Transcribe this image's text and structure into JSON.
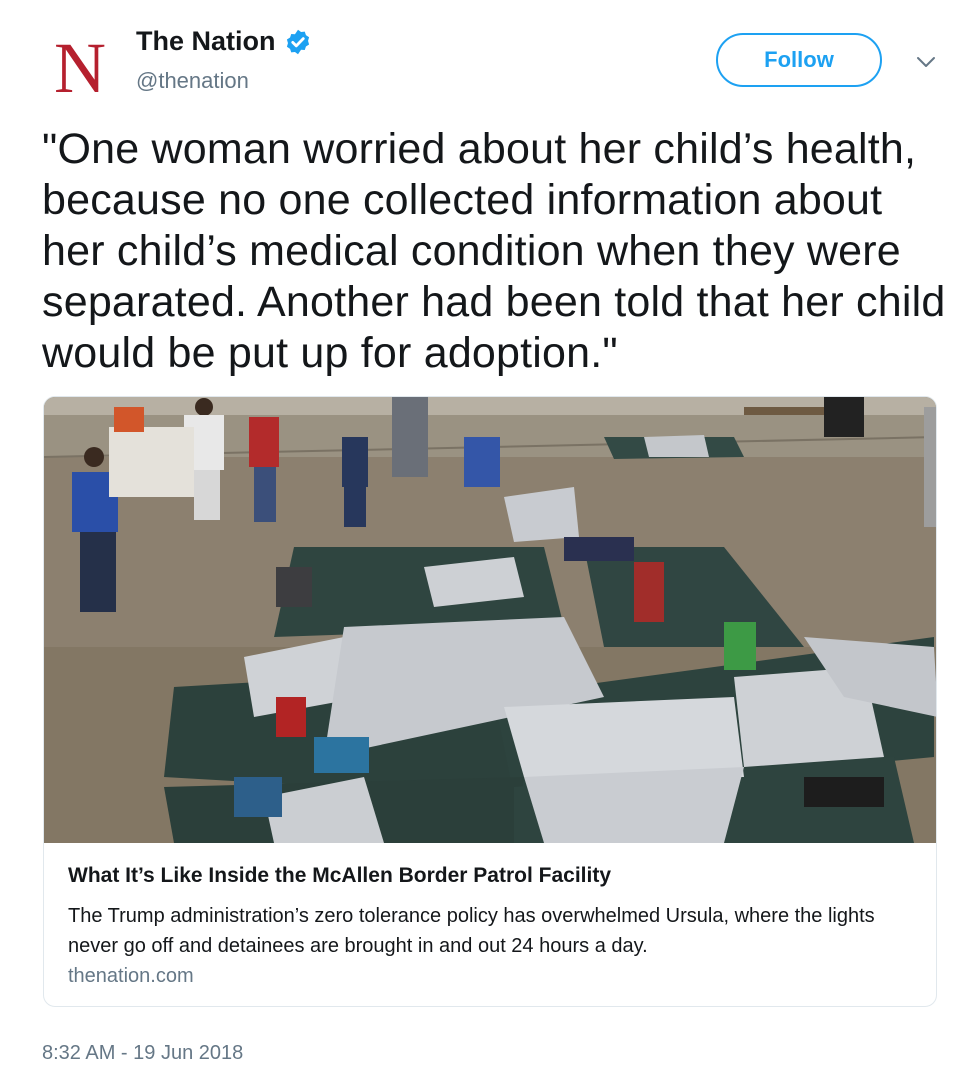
{
  "account": {
    "logo_letter": "N",
    "display_name": "The Nation",
    "handle": "@thenation",
    "verified": true
  },
  "follow_label": "Follow",
  "tweet": {
    "text": "\"One woman worried about her child’s health, because no one collected information about her child’s medical condition when they were separated. Another had been told that her child would be put up for adoption.\"",
    "timestamp": "8:32 AM - 19 Jun 2018"
  },
  "card": {
    "title": "What It’s Like Inside the McAllen Border Patrol Facility",
    "description": "The Trump administration’s zero tolerance policy has overwhelmed Ursula, where the lights never go off and detainees are brought in and out 24 hours a day.",
    "domain": "thenation.com"
  },
  "colors": {
    "accent": "#1da1f2",
    "logo_red": "#b5202e",
    "secondary_text": "#657786"
  }
}
